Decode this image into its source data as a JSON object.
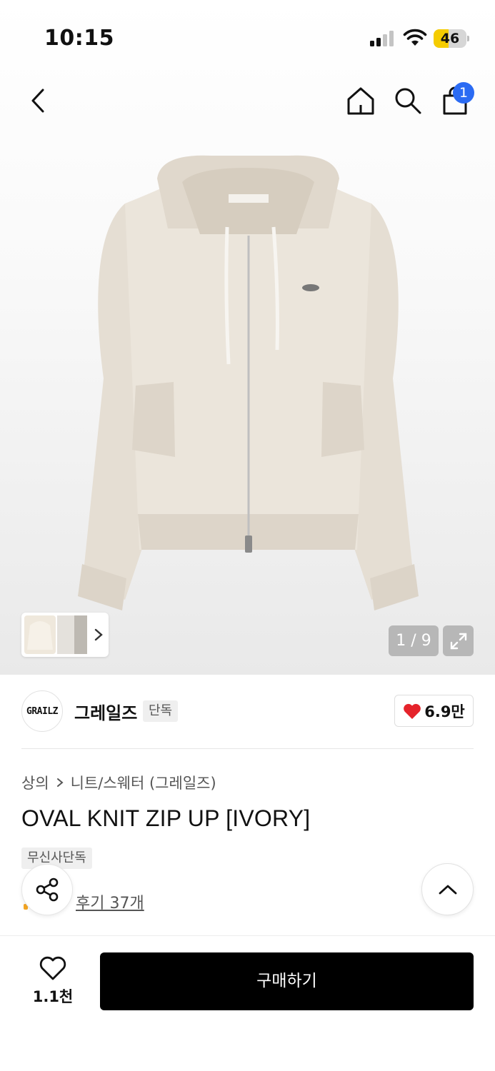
{
  "status_bar": {
    "time": "10:15",
    "battery": "46",
    "battery_level": 0.46
  },
  "nav": {
    "cart_count": "1"
  },
  "gallery": {
    "counter": "1 / 9",
    "current_index": 1,
    "total": 9
  },
  "brand": {
    "logo_text": "GRAILZ",
    "name": "그레일즈",
    "tag": "단독",
    "likes": "6.9만"
  },
  "breadcrumb": {
    "category": "상의",
    "subcategory": "니트/스웨터 (그레일즈)"
  },
  "product": {
    "title": "OVAL KNIT ZIP UP [IVORY]",
    "exclusive_tag": "무신사단독",
    "reviews": "후기 37개"
  },
  "bottom_bar": {
    "wish_count": "1.1천",
    "buy_label": "구매하기"
  },
  "colors": {
    "accent_blue": "#2b6bf3",
    "heart_red": "#e5232b",
    "battery_yellow": "#f5cc00",
    "buy_bg": "#000000"
  },
  "icons": [
    "back-icon",
    "home-icon",
    "search-icon",
    "shopping-bag-icon",
    "chevron-right-icon",
    "expand-icon",
    "heart-icon",
    "share-icon",
    "chevron-up-icon",
    "heart-outline-icon"
  ]
}
